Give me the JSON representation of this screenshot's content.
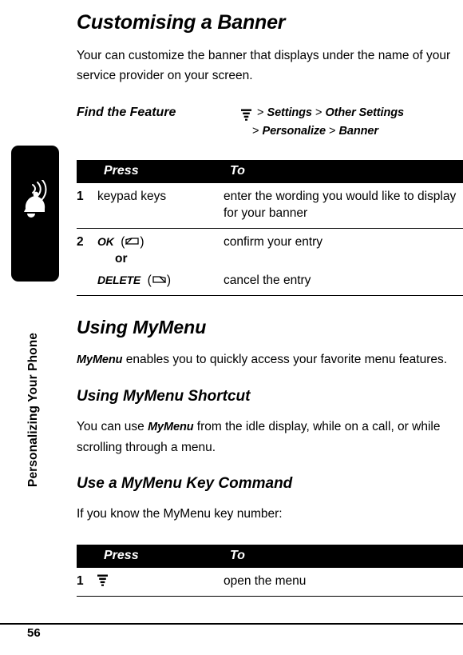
{
  "sidebar": {
    "running_head": "Personalizing Your Phone",
    "icon_name": "bell-ringing-icon"
  },
  "page": {
    "title": "Customising a Banner",
    "intro": "Your can customize the banner that displays under the name of your service provider on your screen.",
    "page_number": "56"
  },
  "find_feature": {
    "label": "Find the Feature",
    "menu_icon": "menu-key-icon",
    "line1": [
      {
        "text": ">",
        "bold": false
      },
      {
        "text": "Settings",
        "bold": true
      },
      {
        "text": ">",
        "bold": false
      },
      {
        "text": "Other Settings",
        "bold": true
      }
    ],
    "line2": [
      {
        "text": ">",
        "bold": false
      },
      {
        "text": "Personalize",
        "bold": true
      },
      {
        "text": ">",
        "bold": false
      },
      {
        "text": "Banner",
        "bold": true
      }
    ]
  },
  "table1": {
    "headers": {
      "num": "",
      "press": "Press",
      "to": "To"
    },
    "rows": [
      {
        "num": "1",
        "press_text": "keypad keys",
        "press_icon": "",
        "to": "enter the wording you would like to display for your banner"
      },
      {
        "num": "2",
        "press_text": "OK",
        "press_icon": "right-softkey-icon",
        "press_paren": true,
        "to": "confirm your entry"
      },
      {
        "num": "",
        "press_text": "or",
        "is_or": true,
        "to": ""
      },
      {
        "num": "",
        "press_text": "DELETE",
        "press_icon": "left-softkey-icon",
        "press_paren": true,
        "to": "cancel the entry"
      }
    ]
  },
  "section_mymenu": {
    "heading": "Using MyMenu",
    "paragraph_pre": "",
    "paragraph_bold": "MyMenu",
    "paragraph_post": " enables you to quickly access your favorite menu features."
  },
  "subsection_shortcut": {
    "heading": "Using MyMenu Shortcut",
    "paragraph_pre": "You can use ",
    "paragraph_bold": "MyMenu",
    "paragraph_post": " from the idle display, while on a call, or while scrolling through a menu."
  },
  "subsection_keycommand": {
    "heading": "Use a MyMenu Key Command",
    "paragraph": "If you know the MyMenu key number:"
  },
  "table2": {
    "headers": {
      "num": "",
      "press": "Press",
      "to": "To"
    },
    "rows": [
      {
        "num": "1",
        "press_text": "",
        "press_icon": "menu-key-icon",
        "to": "open the menu"
      }
    ]
  }
}
